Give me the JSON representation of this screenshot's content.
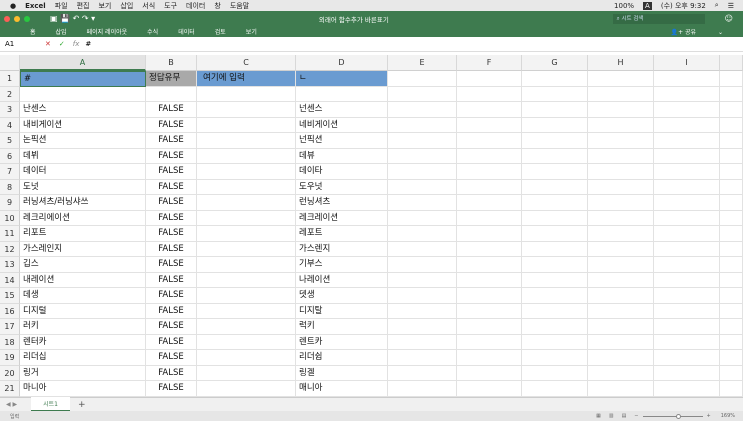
{
  "menubar": {
    "app": "Excel",
    "items": [
      "파일",
      "편집",
      "보기",
      "삽입",
      "서식",
      "도구",
      "데이터",
      "창",
      "도움말"
    ],
    "battery": "100%",
    "clock": "(수) 오후 9:32",
    "input_indicator": "A"
  },
  "window": {
    "title": "외래어 함수추가 바른표기",
    "search_placeholder": "시트 검색"
  },
  "ribbon": {
    "tabs": [
      "홈",
      "삽입",
      "페이지 레이아웃",
      "수식",
      "데이터",
      "검토",
      "보기"
    ],
    "share": "공유"
  },
  "formula_bar": {
    "cell_ref": "A1",
    "fx": "fx",
    "value": "#"
  },
  "columns": [
    "A",
    "B",
    "C",
    "D",
    "E",
    "F",
    "G",
    "H",
    "I"
  ],
  "header_row": {
    "a": "#",
    "b": "정답유무",
    "c": "여기에 입력",
    "d": "ㄴ"
  },
  "rows": [
    {
      "n": "3",
      "a": "난센스",
      "b": "FALSE",
      "d": "넌센스"
    },
    {
      "n": "4",
      "a": "내비게이션",
      "b": "FALSE",
      "d": "네비게이션"
    },
    {
      "n": "5",
      "a": "논픽션",
      "b": "FALSE",
      "d": "넌픽션"
    },
    {
      "n": "6",
      "a": "데뷔",
      "b": "FALSE",
      "d": "데뷰"
    },
    {
      "n": "7",
      "a": "데이터",
      "b": "FALSE",
      "d": "데이타"
    },
    {
      "n": "8",
      "a": "도넛",
      "b": "FALSE",
      "d": "도우넛"
    },
    {
      "n": "9",
      "a": "러닝셔츠/러닝샤쓰",
      "b": "FALSE",
      "d": "런닝셔츠"
    },
    {
      "n": "10",
      "a": "레크리에이션",
      "b": "FALSE",
      "d": "레크레이션"
    },
    {
      "n": "11",
      "a": "리포트",
      "b": "FALSE",
      "d": "레포트"
    },
    {
      "n": "12",
      "a": "가스레인지",
      "b": "FALSE",
      "d": "가스렌지"
    },
    {
      "n": "13",
      "a": "깁스",
      "b": "FALSE",
      "d": "기부스"
    },
    {
      "n": "14",
      "a": "내레이션",
      "b": "FALSE",
      "d": "나레이션"
    },
    {
      "n": "15",
      "a": "데생",
      "b": "FALSE",
      "d": "뎃생"
    },
    {
      "n": "16",
      "a": "디지털",
      "b": "FALSE",
      "d": "디지탈"
    },
    {
      "n": "17",
      "a": "러키",
      "b": "FALSE",
      "d": "럭키"
    },
    {
      "n": "18",
      "a": "렌터카",
      "b": "FALSE",
      "d": "렌트카"
    },
    {
      "n": "19",
      "a": "리더십",
      "b": "FALSE",
      "d": "리더쉽"
    },
    {
      "n": "20",
      "a": "링거",
      "b": "FALSE",
      "d": "링겔"
    },
    {
      "n": "21",
      "a": "마니아",
      "b": "FALSE",
      "d": "매니아"
    }
  ],
  "sheet_tab": "시트1",
  "add_sheet": "+",
  "status": {
    "mode": "입력",
    "zoom": "169%",
    "zoom_fraction": 0.55
  }
}
